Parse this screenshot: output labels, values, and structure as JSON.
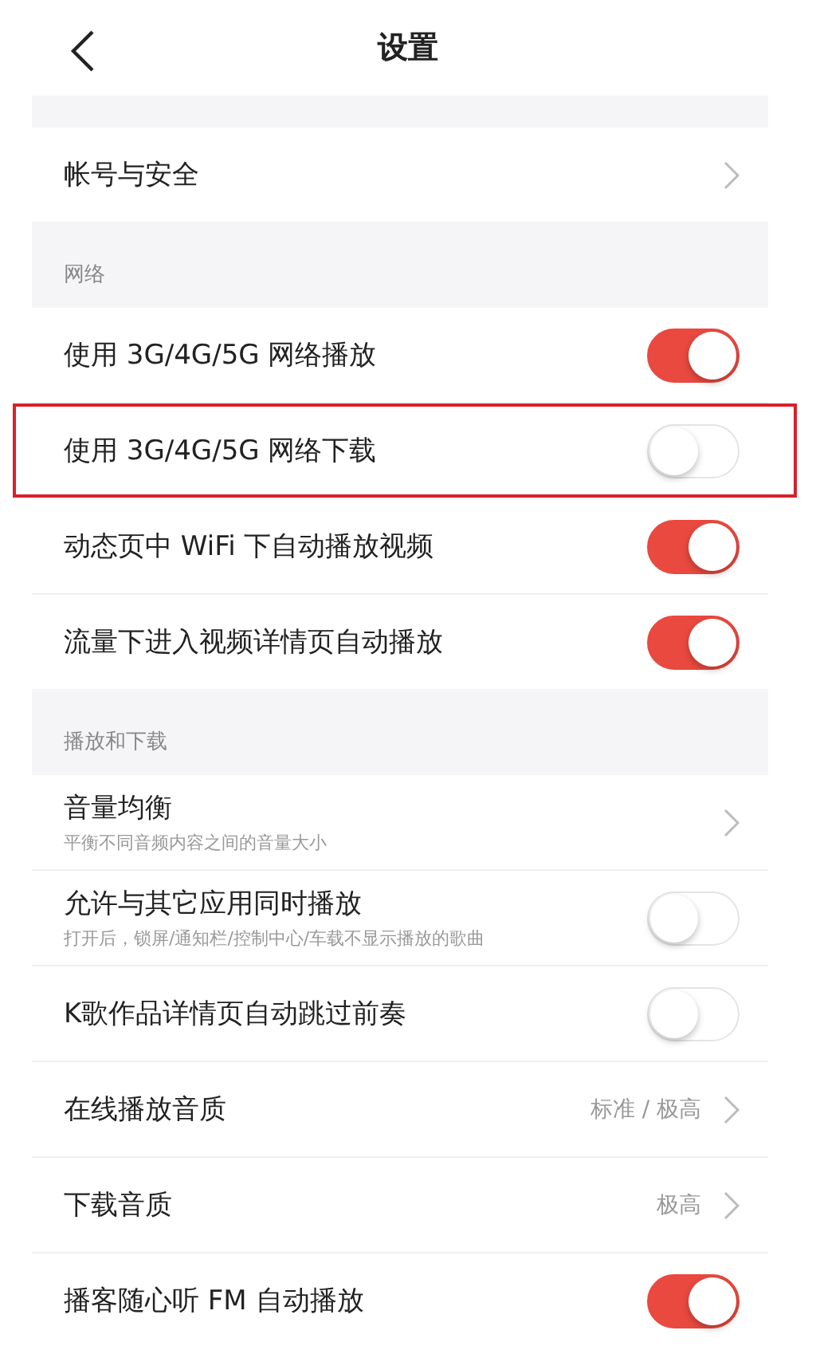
{
  "header": {
    "title": "设置"
  },
  "sections": [
    {
      "rows": [
        {
          "kind": "link",
          "label": "帐号与安全",
          "highlighted": false
        }
      ]
    },
    {
      "title": "网络",
      "rows": [
        {
          "kind": "toggle",
          "label": "使用 3G/4G/5G 网络播放",
          "on": true,
          "highlighted": false
        },
        {
          "kind": "toggle",
          "label": "使用 3G/4G/5G 网络下载",
          "on": false,
          "highlighted": true
        },
        {
          "kind": "toggle",
          "label": "动态页中 WiFi 下自动播放视频",
          "on": true,
          "highlighted": false
        },
        {
          "kind": "toggle",
          "label": "流量下进入视频详情页自动播放",
          "on": true,
          "highlighted": false
        }
      ]
    },
    {
      "title": "播放和下载",
      "rows": [
        {
          "kind": "link",
          "label": "音量均衡",
          "subtitle": "平衡不同音频内容之间的音量大小",
          "highlighted": false
        },
        {
          "kind": "toggle",
          "label": "允许与其它应用同时播放",
          "subtitle": "打开后，锁屏/通知栏/控制中心/车载不显示播放的歌曲",
          "on": false,
          "highlighted": false
        },
        {
          "kind": "toggle",
          "label": "K歌作品详情页自动跳过前奏",
          "on": false,
          "highlighted": false
        },
        {
          "kind": "link",
          "label": "在线播放音质",
          "value": "标准 / 极高",
          "highlighted": false
        },
        {
          "kind": "link",
          "label": "下载音质",
          "value": "极高",
          "highlighted": false
        },
        {
          "kind": "toggle",
          "label": "播客随心听 FM 自动播放",
          "on": true,
          "highlighted": false
        }
      ]
    }
  ]
}
